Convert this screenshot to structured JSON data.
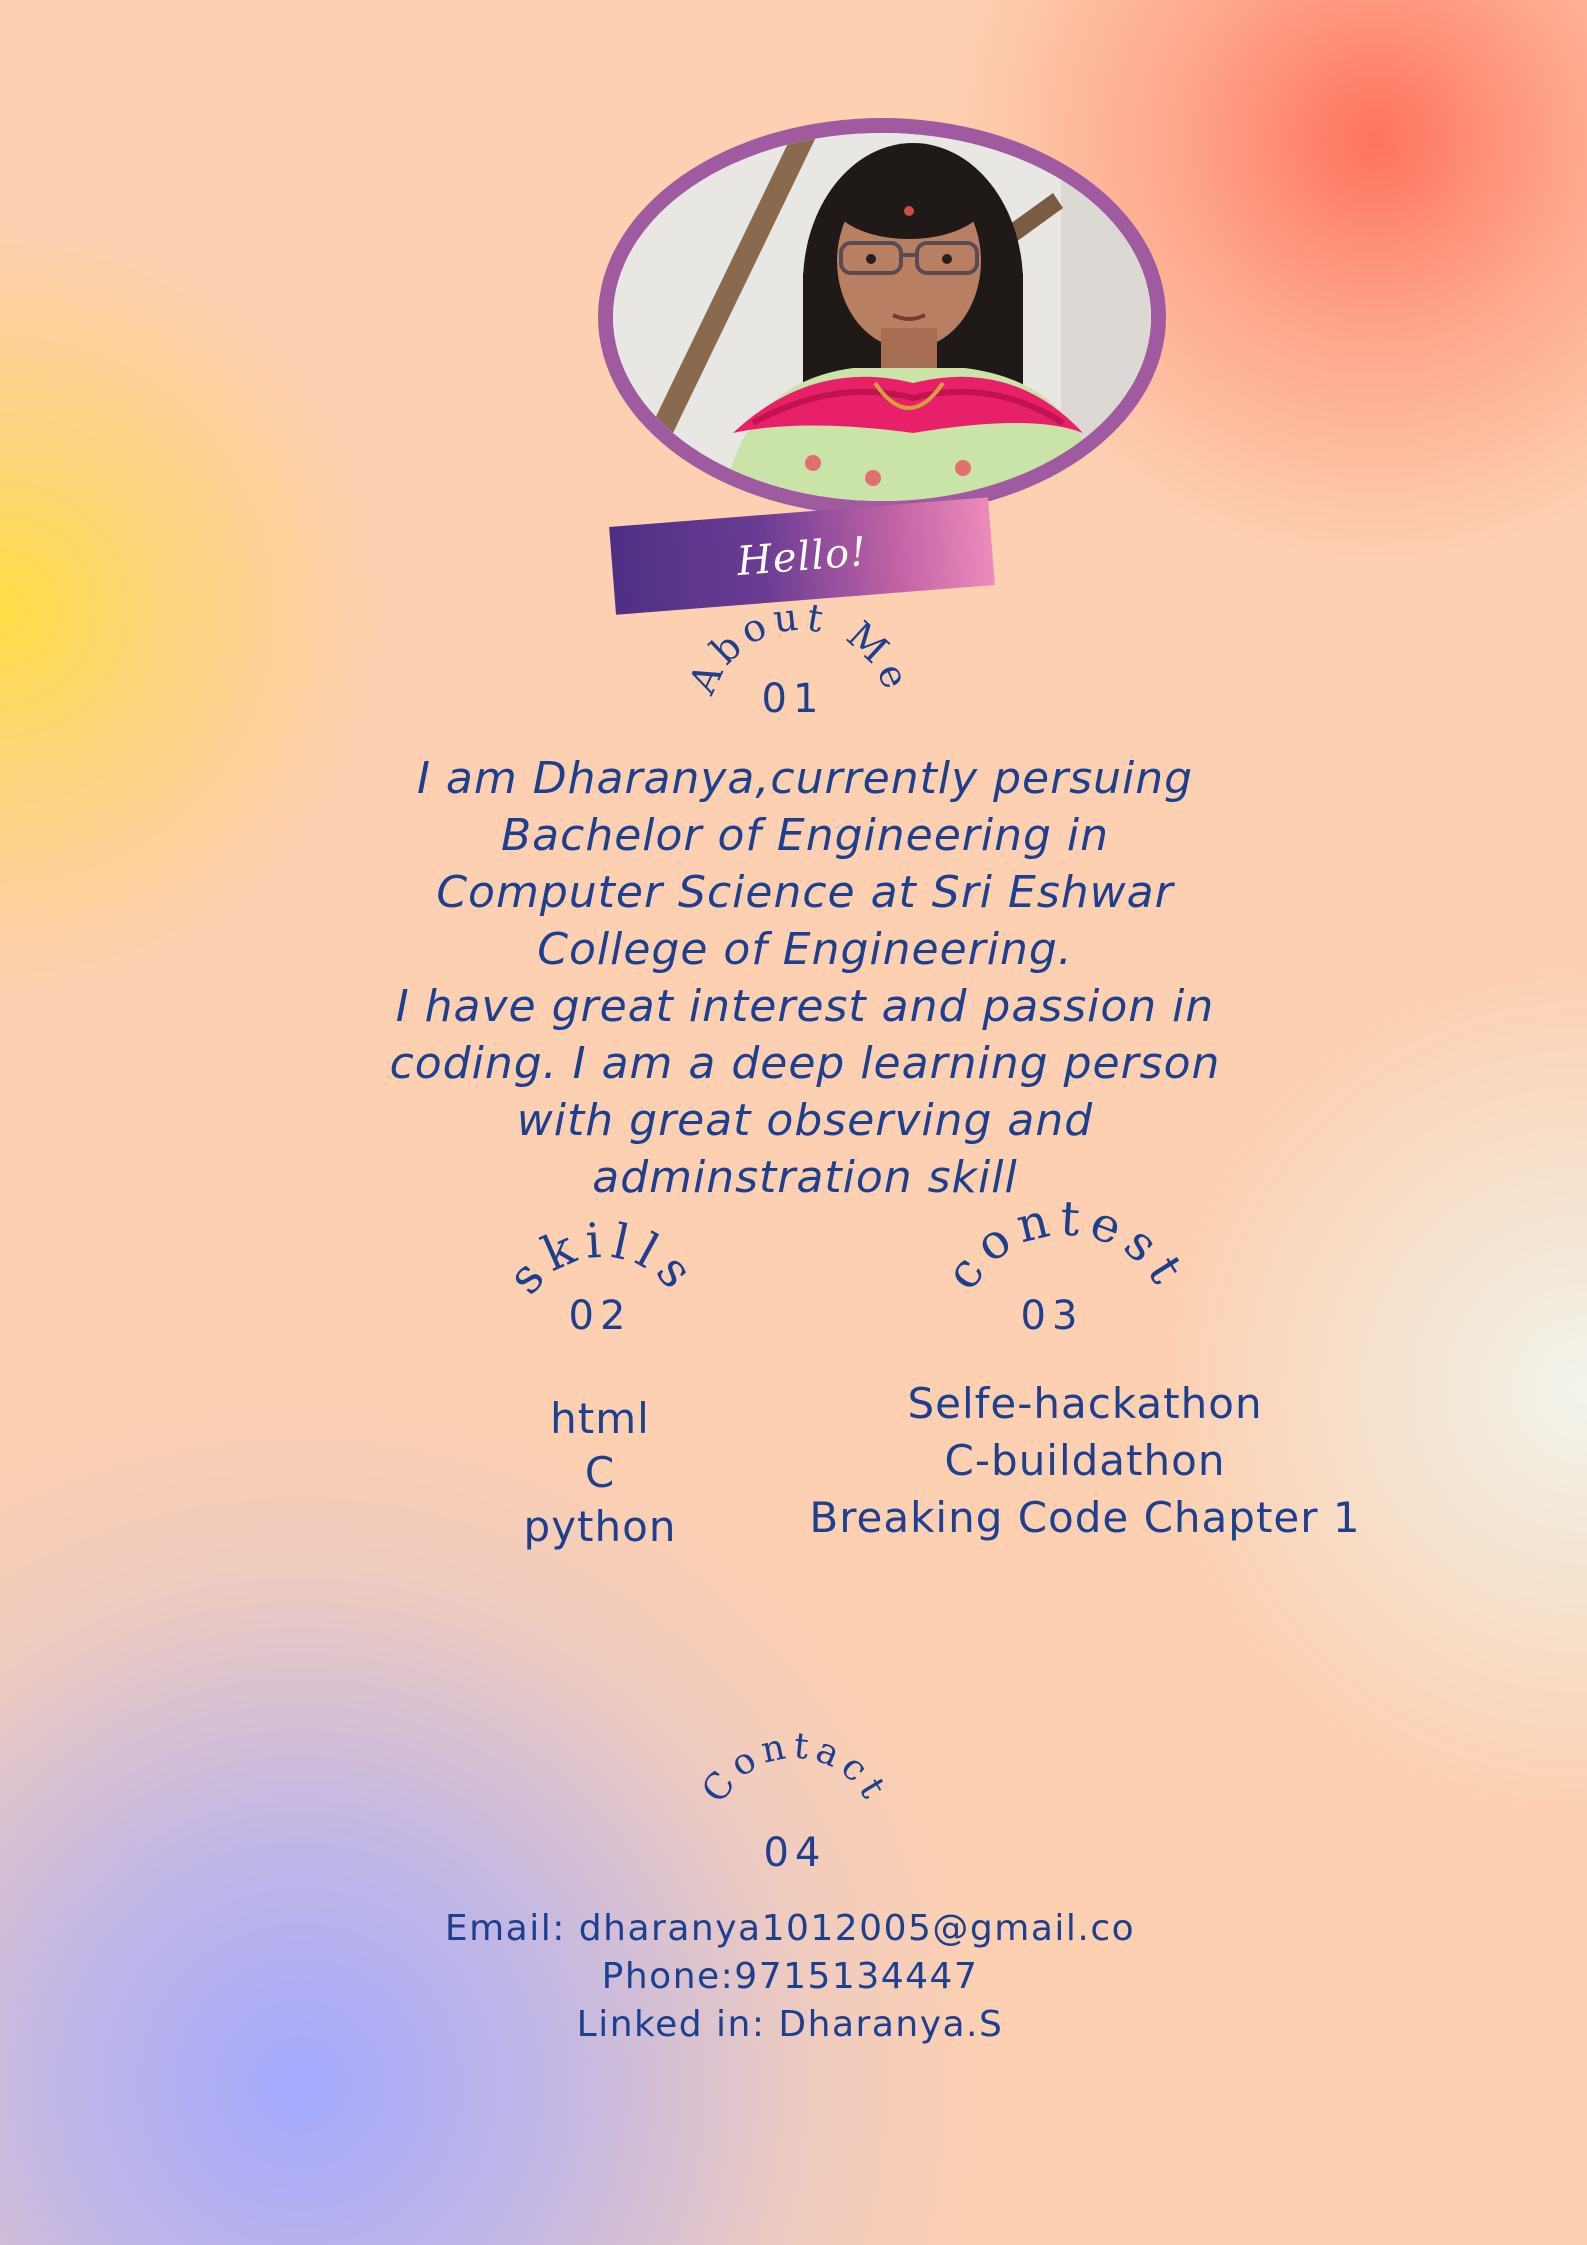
{
  "hello_tag": "Hello!",
  "about": {
    "heading": "About Me",
    "number": "01",
    "text": "I am Dharanya,currently persuing\nBachelor of Engineering in\nComputer Science at Sri Eshwar\nCollege of Engineering.\nI have great interest and passion in\ncoding. I am a deep learning person\nwith great observing and\nadminstration skill"
  },
  "skills": {
    "heading": "skills",
    "number": "02",
    "items": [
      "html",
      "C",
      "python"
    ]
  },
  "contest": {
    "heading": "contest",
    "number": "03",
    "items": [
      "Selfe-hackathon",
      "C-buildathon",
      "Breaking Code Chapter 1"
    ]
  },
  "contact": {
    "heading": "Contact",
    "number": "04",
    "email": "Email: dharanya1012005@gmail.co",
    "phone": "Phone:9715134447",
    "linkedin": "Linked in: Dharanya.S"
  },
  "colors": {
    "text": "#1d3f8f",
    "frame": "#a05aa0",
    "tag_start": "#4e2f85",
    "tag_end": "#ec8bbb"
  }
}
